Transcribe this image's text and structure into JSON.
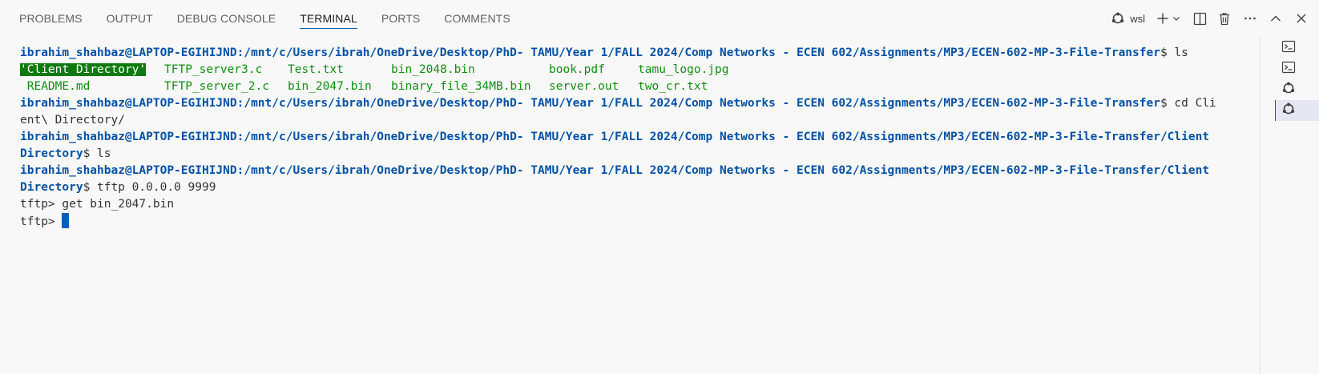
{
  "panel": {
    "tabs": [
      {
        "label": "PROBLEMS"
      },
      {
        "label": "OUTPUT"
      },
      {
        "label": "DEBUG CONSOLE"
      },
      {
        "label": "TERMINAL"
      },
      {
        "label": "PORTS"
      },
      {
        "label": "COMMENTS"
      }
    ],
    "active_tab": "TERMINAL",
    "shell_label": "wsl",
    "accent_color": "#005fb8"
  },
  "terminal": {
    "prompt": "ibrahim_shahbaz@LAPTOP-EGIHIJND:/mnt/c/Users/ibrah/OneDrive/Desktop/PhD- TAMU/Year 1/FALL 2024/Comp Networks - ECEN 602/Assignments/MP3/ECEN-602-MP-3-File-Transfer",
    "line1_cmd": "$ ls",
    "ls_row1": [
      "'Client Directory'",
      "TFTP_server3.c",
      "Test.txt",
      "bin_2048.bin",
      "book.pdf",
      "tamu_logo.jpg"
    ],
    "ls_row2": [
      " README.md",
      "TFTP_server_2.c",
      "bin_2047.bin",
      "binary_file_34MB.bin",
      "server.out",
      "two_cr.txt"
    ],
    "line4_cmd": "$ cd Cli",
    "line5_cont": "ent\\ Directory/",
    "line6_prompt": "ibrahim_shahbaz@LAPTOP-EGIHIJND:/mnt/c/Users/ibrah/OneDrive/Desktop/PhD- TAMU/Year 1/FALL 2024/Comp Networks - ECEN 602/Assignments/MP3/ECEN-602-MP-3-File-Transfer/Client",
    "line7_prompt": "Directory",
    "line7_cmd": "$ ls",
    "line8_prompt": "ibrahim_shahbaz@LAPTOP-EGIHIJND:/mnt/c/Users/ibrah/OneDrive/Desktop/PhD- TAMU/Year 1/FALL 2024/Comp Networks - ECEN 602/Assignments/MP3/ECEN-602-MP-3-File-Transfer/Client",
    "line9_prompt": "Directory",
    "line9_cmd": "$ tftp 0.0.0.0 9999",
    "line10": "tftp> get bin_2047.bin",
    "line11": "tftp> ",
    "colors": {
      "prompt": "#0451a5",
      "directory_highlight": "#0f7a0f",
      "file": "#108f10",
      "cursor": "#005fb8"
    }
  },
  "icons": {
    "shell": "debug-console-icon",
    "new_terminal": "plus-icon",
    "launch_profile": "chevron-down-icon",
    "split": "split-editor-icon",
    "kill": "trash-icon",
    "more": "ellipsis-icon",
    "maximize": "chevron-up-icon",
    "close": "close-icon"
  },
  "side_list": {
    "items": [
      {
        "icon": "terminal-icon",
        "active": false
      },
      {
        "icon": "terminal-icon",
        "active": false
      },
      {
        "icon": "debug-console-icon",
        "active": false
      },
      {
        "icon": "debug-console-icon",
        "active": true
      }
    ]
  }
}
